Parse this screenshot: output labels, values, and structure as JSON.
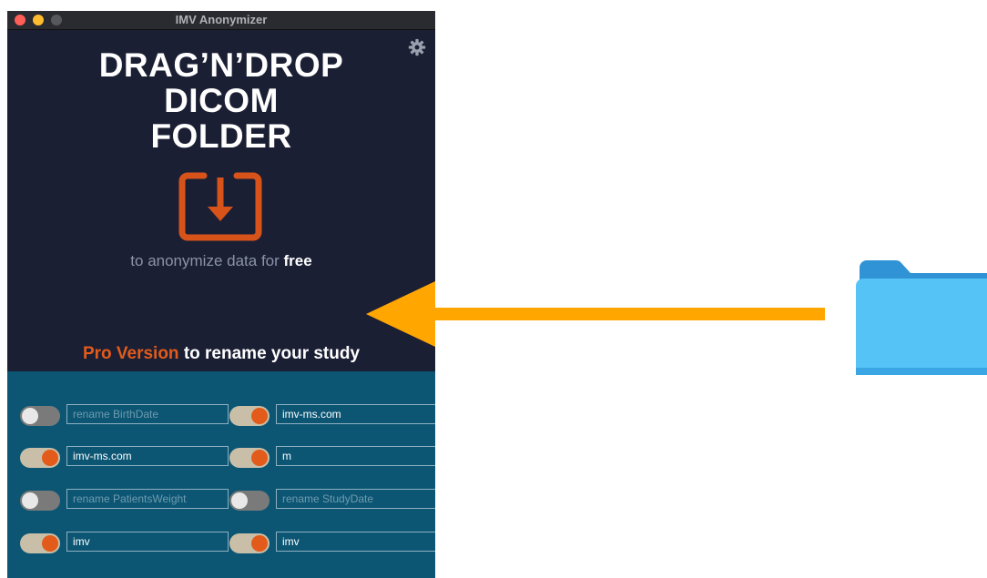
{
  "window": {
    "title": "IMV Anonymizer"
  },
  "drop_area": {
    "heading_line1": "DRAG’N’DROP",
    "heading_line2": "DICOM",
    "heading_line3": "FOLDER",
    "subtitle_prefix": "to anonymize data for ",
    "subtitle_bold": "free"
  },
  "pro": {
    "highlight": "Pro Version",
    "rest": " to rename your study"
  },
  "settings": {
    "rows": [
      {
        "left": {
          "enabled": false,
          "value": "",
          "placeholder": "rename BirthDate"
        },
        "right": {
          "enabled": true,
          "value": "imv-ms.com",
          "placeholder": ""
        }
      },
      {
        "left": {
          "enabled": true,
          "value": "imv-ms.com",
          "placeholder": ""
        },
        "right": {
          "enabled": true,
          "value": "m",
          "placeholder": ""
        }
      },
      {
        "left": {
          "enabled": false,
          "value": "",
          "placeholder": "rename PatientsWeight"
        },
        "right": {
          "enabled": false,
          "value": "",
          "placeholder": "rename StudyDate"
        }
      },
      {
        "left": {
          "enabled": true,
          "value": "imv",
          "placeholder": ""
        },
        "right": {
          "enabled": true,
          "value": "imv",
          "placeholder": ""
        }
      }
    ]
  },
  "colors": {
    "window_bg": "#1b1f34",
    "settings_bg": "#0c5674",
    "accent_orange": "#e35b1a",
    "arrow_orange": "#ffa700",
    "folder_blue": "#4fb8f0"
  },
  "icons": {
    "settings": "gear-icon",
    "drop": "download-tray-icon",
    "folder": "folder-icon"
  }
}
